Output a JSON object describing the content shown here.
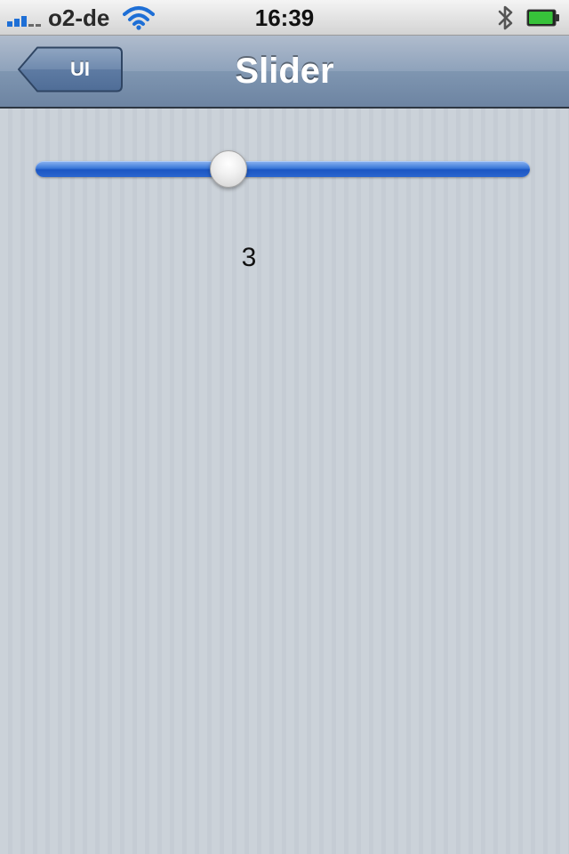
{
  "status_bar": {
    "carrier": "o2-de",
    "time": "16:39",
    "signal_bars": 3,
    "signal_max": 5,
    "battery_level": 0.95,
    "colors": {
      "signal": "#1e6fd6",
      "battery": "#37c23a"
    },
    "icons": [
      "signal-icon",
      "wifi-icon",
      "bluetooth-icon",
      "battery-icon"
    ]
  },
  "nav_bar": {
    "back_label": "UI",
    "title": "Slider"
  },
  "slider": {
    "value_fraction": 0.39,
    "colors": {
      "track": "#2a66cf"
    }
  },
  "value_label": "3"
}
